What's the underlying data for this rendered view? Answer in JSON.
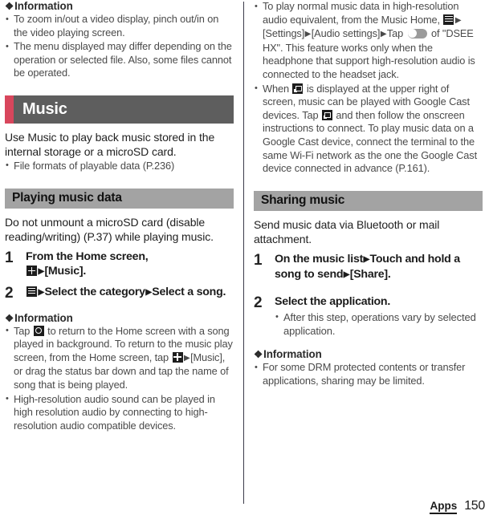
{
  "page": {
    "number": "150",
    "chapter_footer": "Apps"
  },
  "left_column": {
    "info_top": {
      "glyph": "❖",
      "heading": "Information",
      "items": [
        "To zoom in/out a video display, pinch out/in on the video playing screen.",
        "The menu displayed may differ depending on the operation or selected file. Also, some files cannot be operated."
      ]
    },
    "chapter": {
      "title": "Music",
      "accent_color": "#d8465c",
      "bg_color": "#5e5e5e"
    },
    "intro": "Use Music to play back music stored in the internal storage or a microSD card.",
    "intro_bullets": [
      "File formats of playable data (P.236)"
    ],
    "section": {
      "title": "Playing music data",
      "bg_color": "#a3a3a3"
    },
    "section_intro": "Do not unmount a microSD card (disable reading/writing) (P.37) while playing music.",
    "steps": [
      {
        "number": "1",
        "line1": "From the Home screen,",
        "icon": "app-drawer-grid-icon",
        "arrow": "▶",
        "line2_after_icon": "[Music]."
      },
      {
        "number": "2",
        "icon": "list-menu-icon",
        "arrow": "▶",
        "text_a": "Select the category",
        "text_b": "Select a song."
      }
    ],
    "info_bottom": {
      "glyph": "❖",
      "heading": "Information",
      "item1": {
        "pre": "Tap",
        "icon1": "home-button-icon",
        "mid": "to return to the Home screen with a song played in background. To return to the music play screen, from the Home screen, tap",
        "icon2": "app-drawer-grid-icon",
        "arrow": "▶",
        "post": "[Music], or drag the status bar down and tap the name of song that is being played."
      },
      "item2": "High-resolution audio sound can be played in high resolution audio by connecting to high-resolution audio compatible devices."
    }
  },
  "right_column": {
    "bullets_top": {
      "item1": {
        "pre": "To play normal music data in high-resolution audio equivalent, from the Music Home,",
        "icon_menu": "list-menu-icon",
        "arrow1": "▶",
        "settings": "[Settings]",
        "arrow2": "▶",
        "audio_settings": "[Audio settings]",
        "arrow3": "▶",
        "tap": "Tap",
        "icon_toggle": "toggle-switch-off-icon",
        "post": "of \"DSEE HX\". This feature works only when the headphone that support high-resolution audio is connected to the headset jack."
      },
      "item2": {
        "pre": "When",
        "icon1": "google-cast-icon",
        "mid": "is displayed at the upper right of screen, music can be played with Google Cast devices. Tap",
        "icon2": "google-cast-icon",
        "post": "and then follow the onscreen instructions to connect. To play music data on a Google Cast device, connect the terminal to the same Wi-Fi network as the one the Google Cast device connected in advance (P.161)."
      }
    },
    "section": {
      "title": "Sharing music",
      "bg_color": "#a3a3a3"
    },
    "section_intro": "Send music data via Bluetooth or mail attachment.",
    "steps": [
      {
        "number": "1",
        "text_a": "On the music list",
        "arrow": "▶",
        "text_b": "Touch and hold a song to send",
        "text_c": "[Share]."
      },
      {
        "number": "2",
        "text": "Select the application.",
        "sub_bullets": [
          "After this step, operations vary by selected application."
        ]
      }
    ],
    "info": {
      "glyph": "❖",
      "heading": "Information",
      "items": [
        "For some DRM protected contents or transfer applications, sharing may be limited."
      ]
    }
  }
}
